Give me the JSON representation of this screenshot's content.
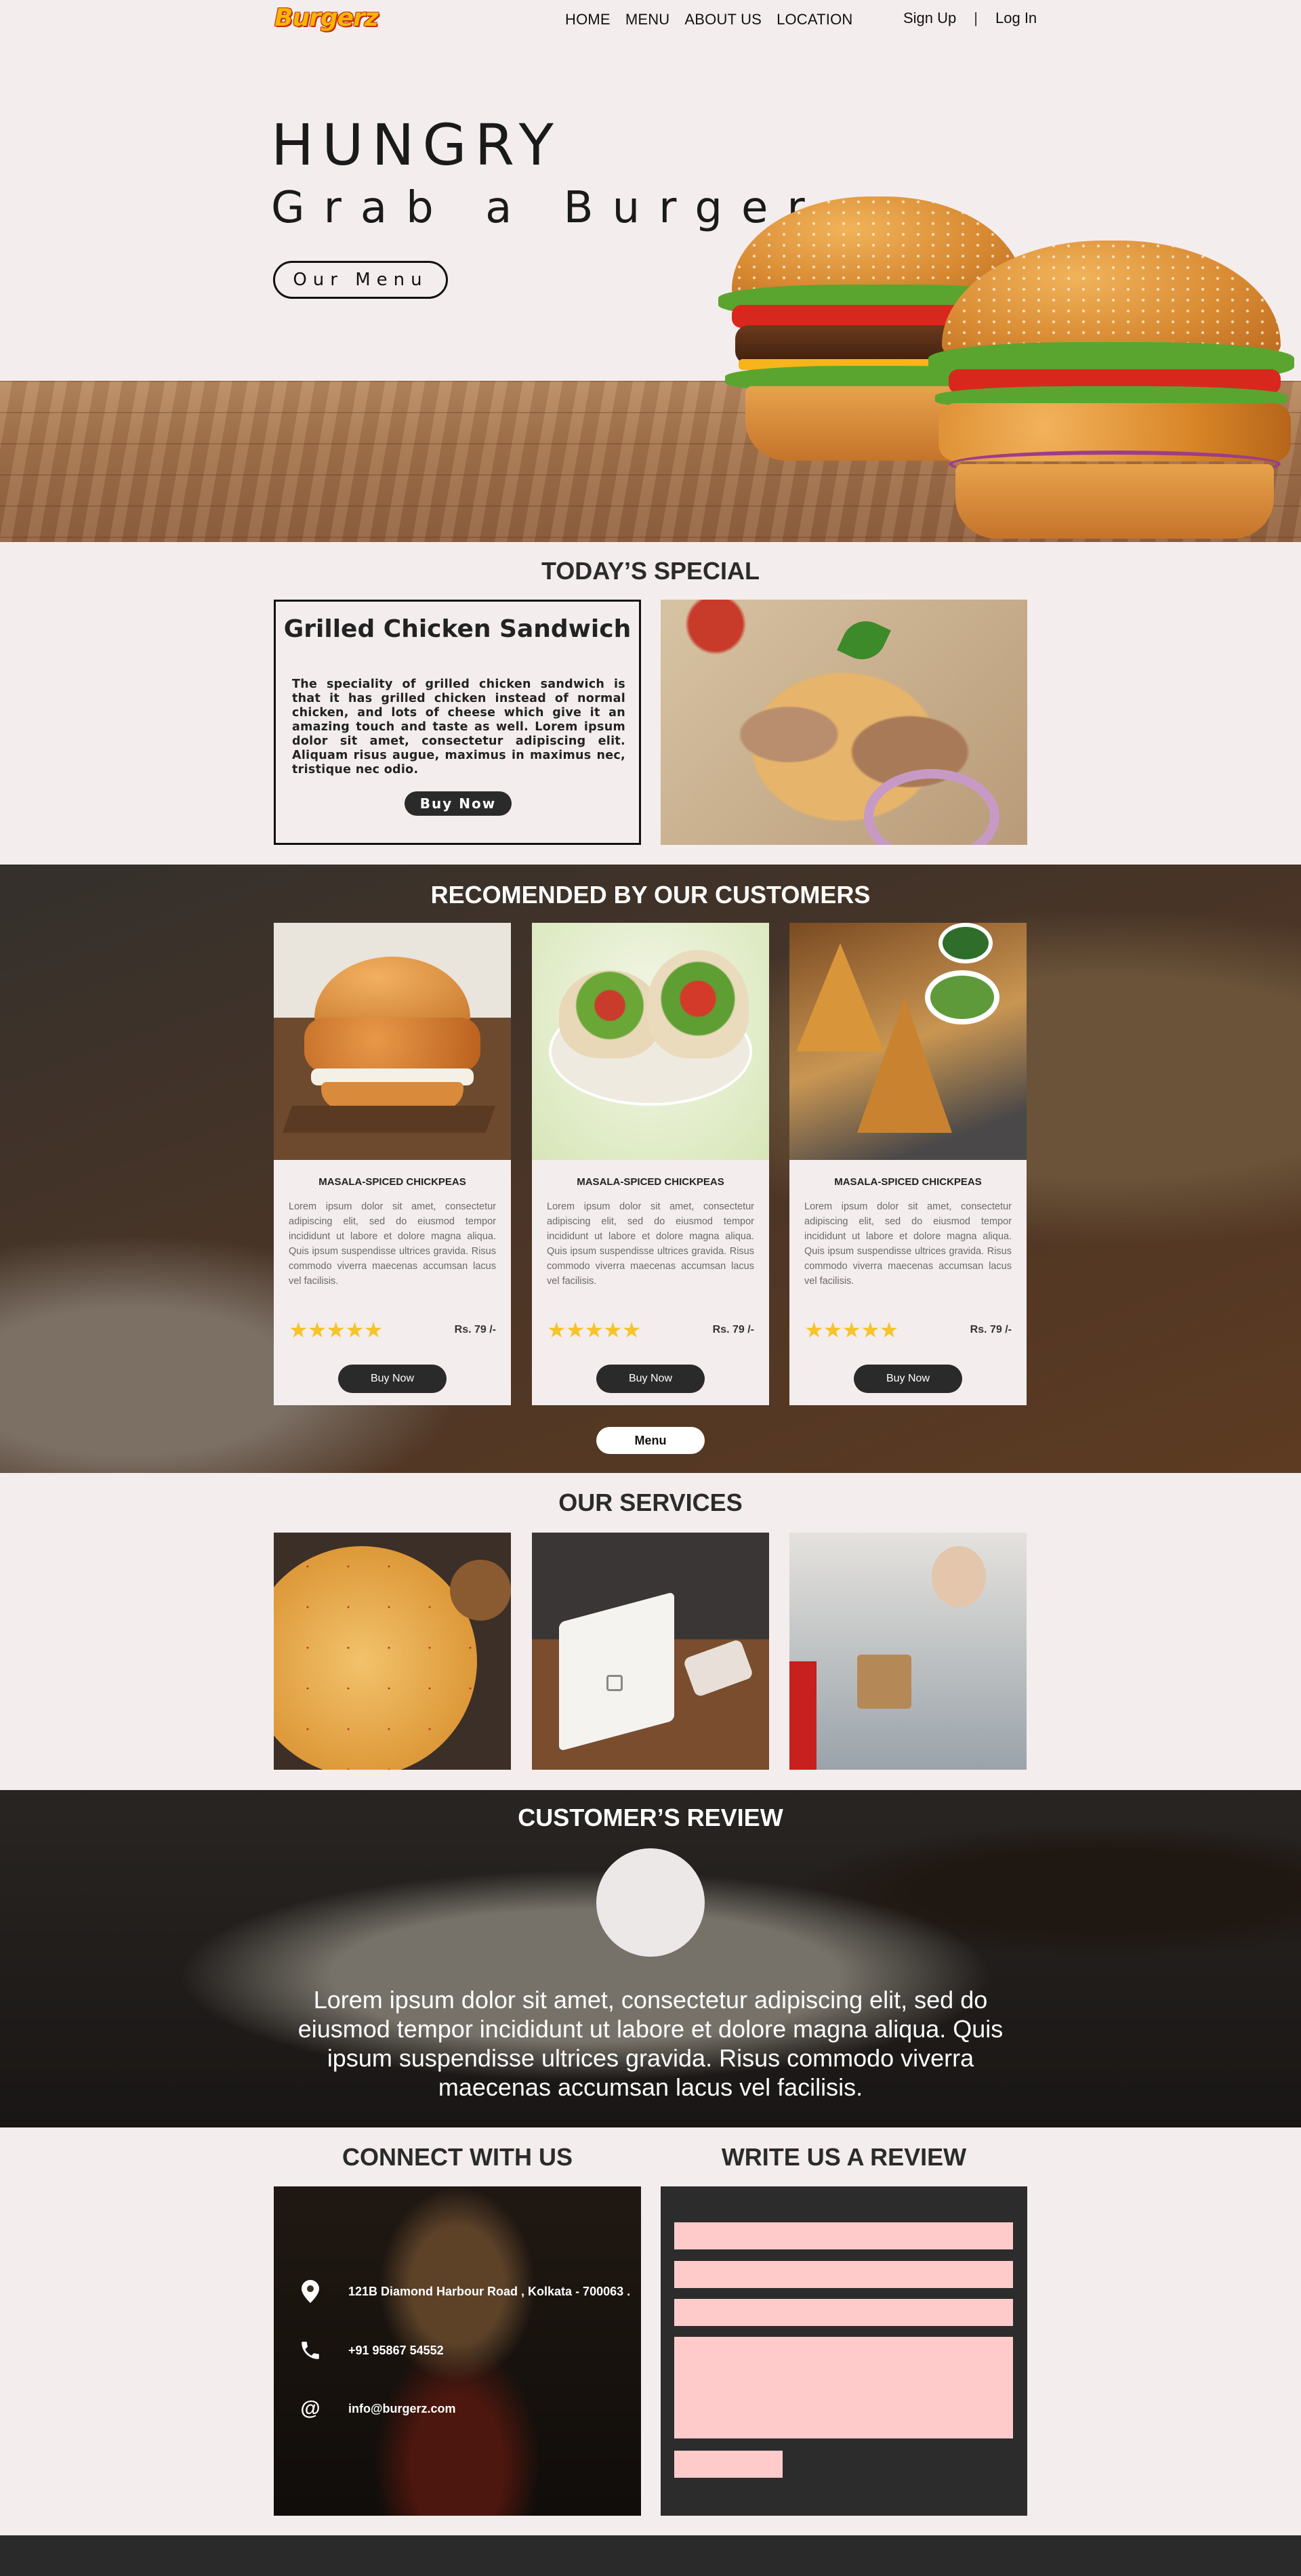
{
  "brand": {
    "logo": "Burgerz"
  },
  "nav": {
    "items": [
      "HOME",
      "MENU",
      "ABOUT US",
      "LOCATION"
    ],
    "sign_up": "Sign Up",
    "separator": "|",
    "log_in": "Log In"
  },
  "hero": {
    "title": "HUNGRY",
    "subtitle": "Grab a Burger",
    "button": "Our Menu"
  },
  "special": {
    "section_title": "TODAY’S SPECIAL",
    "dish": "Grilled Chicken Sandwich",
    "description": "The speciality of grilled chicken sandwich is that it has grilled chicken instead of normal chicken, and lots of cheese which give it an amazing touch and taste as well. Lorem ipsum dolor sit amet, consectetur adipiscing elit. Aliquam risus augue, maximus in maximus nec, tristique nec odio.",
    "button": "Buy Now"
  },
  "recommended": {
    "section_title": "RECOMENDED BY OUR CUSTOMERS",
    "cards": [
      {
        "name": "MASALA-SPICED CHICKPEAS",
        "description": "Lorem ipsum dolor sit amet, consectetur adipiscing elit, sed do eiusmod tempor incididunt ut labore et dolore magna aliqua. Quis ipsum suspendisse ultrices gravida. Risus commodo viverra maecenas accumsan lacus vel facilisis.",
        "stars": "★★★★★",
        "rating": 5,
        "price": "Rs. 79 /-",
        "button": "Buy Now",
        "image": "chicken-burger"
      },
      {
        "name": "MASALA-SPICED CHICKPEAS",
        "description": "Lorem ipsum dolor sit amet, consectetur adipiscing elit, sed do eiusmod tempor incididunt ut labore et dolore magna aliqua. Quis ipsum suspendisse ultrices gravida. Risus commodo viverra maecenas accumsan lacus vel facilisis.",
        "stars": "★★★★★",
        "rating": 5,
        "price": "Rs. 79 /-",
        "button": "Buy Now",
        "image": "wrap"
      },
      {
        "name": "MASALA-SPICED CHICKPEAS",
        "description": "Lorem ipsum dolor sit amet, consectetur adipiscing elit, sed do eiusmod tempor incididunt ut labore et dolore magna aliqua. Quis ipsum suspendisse ultrices gravida. Risus commodo viverra maecenas accumsan lacus vel facilisis.",
        "stars": "★★★★★",
        "rating": 5,
        "price": "Rs. 79 /-",
        "button": "Buy Now",
        "image": "samosa"
      }
    ],
    "menu_button": "Menu"
  },
  "services": {
    "section_title": "OUR SERVICES",
    "images": [
      "pizza",
      "card-payment",
      "takeaway-packing"
    ]
  },
  "review": {
    "section_title": "CUSTOMER’S REVIEW",
    "text": "Lorem ipsum dolor sit amet, consectetur adipiscing elit, sed do eiusmod tempor incididunt ut labore et dolore magna aliqua. Quis ipsum suspendisse ultrices gravida. Risus commodo viverra maecenas accumsan lacus vel facilisis."
  },
  "connect": {
    "section_title": "CONNECT WITH US",
    "address": "121B Diamond Harbour Road , Kolkata - 700063 .",
    "phone": "+91 95867 54552",
    "email": "info@burgerz.com",
    "icons": [
      "location-pin-icon",
      "phone-icon",
      "at-icon"
    ]
  },
  "write_review": {
    "section_title": "WRITE US A REVIEW"
  },
  "colors": {
    "background": "#f4eded",
    "dark": "#2a2a2a",
    "form_field": "#fecaca",
    "star": "#f5c42a",
    "logo_yellow": "#f7b500",
    "logo_red": "#c62a12"
  }
}
